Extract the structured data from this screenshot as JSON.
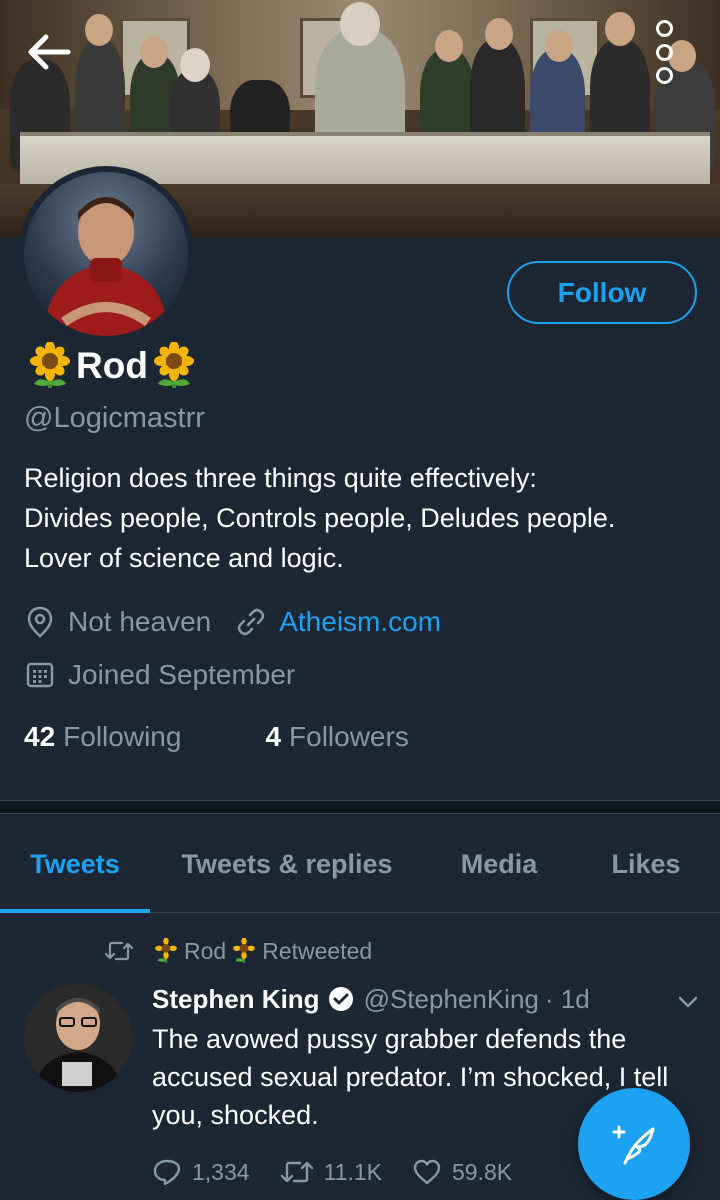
{
  "header": {
    "back_icon": "arrow-left-icon",
    "more_icon": "more-vertical-icon"
  },
  "profile": {
    "display_name": "Rod",
    "name_emoji": "🌻",
    "handle": "@Logicmastrr",
    "bio": "Religion does three things quite effectively:\nDivides people, Controls people, Deludes people.\nLover of science and logic.",
    "location": "Not heaven",
    "website": "Atheism.com",
    "joined": "Joined September",
    "following_count": "42",
    "following_label": "Following",
    "followers_count": "4",
    "followers_label": "Followers",
    "follow_label": "Follow"
  },
  "tabs": [
    {
      "label": "Tweets",
      "active": true
    },
    {
      "label": "Tweets & replies",
      "active": false
    },
    {
      "label": "Media",
      "active": false
    },
    {
      "label": "Likes",
      "active": false
    }
  ],
  "tweet": {
    "retweeted_by": "Rod",
    "retweeted_label": "Retweeted",
    "author": "Stephen King",
    "handle": "@StephenKing",
    "time": "· 1d",
    "text": "The avowed pussy grabber defends the accused sexual predator. I’m shocked, I tell you, shocked.",
    "replies": "1,334",
    "retweets": "11.1K",
    "likes": "59.8K"
  },
  "colors": {
    "background": "#1c2733",
    "accent": "#1da1f2",
    "muted": "#8899a6"
  }
}
